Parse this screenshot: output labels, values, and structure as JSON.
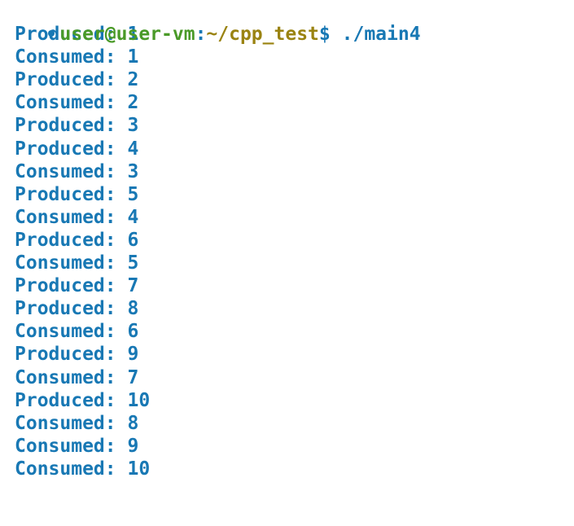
{
  "terminal": {
    "background_color": "#ffffff",
    "font_family_hint": "monospace-bold",
    "colors": {
      "user_green": "#4a9a28",
      "punct_blue": "#1878b4",
      "path_gold": "#9a8311",
      "output_blue": "#1878b4",
      "bullet_blue": "#1878b4"
    },
    "prompt": {
      "bullet": "•",
      "user_host": "user@user-vm",
      "separator": ":",
      "path": "~/cpp_test",
      "dollar": "$",
      "space": " ",
      "command": "./main4"
    },
    "output_lines": [
      "Produced: 1",
      "Consumed: 1",
      "Produced: 2",
      "Consumed: 2",
      "Produced: 3",
      "Produced: 4",
      "Consumed: 3",
      "Produced: 5",
      "Consumed: 4",
      "Produced: 6",
      "Consumed: 5",
      "Produced: 7",
      "Produced: 8",
      "Consumed: 6",
      "Produced: 9",
      "Consumed: 7",
      "Produced: 10",
      "Consumed: 8",
      "Consumed: 9",
      "Consumed: 10"
    ]
  }
}
